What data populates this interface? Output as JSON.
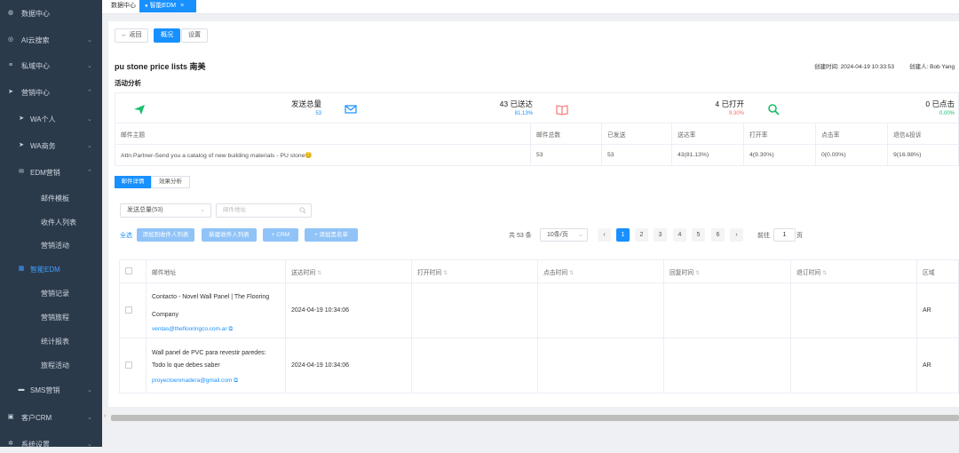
{
  "sidebar": {
    "items": [
      {
        "label": "数据中心",
        "icon": "dashboard-icon",
        "level": 0,
        "chevron": false
      },
      {
        "label": "AI云搜索",
        "icon": "globe-icon",
        "level": 0,
        "chevron": true
      },
      {
        "label": "私域中心",
        "icon": "list-icon",
        "level": 0,
        "chevron": true
      },
      {
        "label": "营销中心",
        "icon": "send-icon",
        "level": 0,
        "chevron": true
      },
      {
        "label": "WA个人",
        "icon": "send-icon",
        "level": 1,
        "chevron": true
      },
      {
        "label": "WA商务",
        "icon": "send-icon",
        "level": 1,
        "chevron": true
      },
      {
        "label": "EDM营销",
        "icon": "mail-icon",
        "level": 1,
        "chevron": true
      },
      {
        "label": "邮件模板",
        "icon": "",
        "level": 2,
        "chevron": false
      },
      {
        "label": "收件人列表",
        "icon": "",
        "level": 2,
        "chevron": false
      },
      {
        "label": "营销活动",
        "icon": "",
        "level": 2,
        "chevron": false
      },
      {
        "label": "智能EDM",
        "icon": "grid-icon",
        "level": 1,
        "chevron": false,
        "active": true
      },
      {
        "label": "营销记录",
        "icon": "",
        "level": 2,
        "chevron": false
      },
      {
        "label": "营销旅程",
        "icon": "",
        "level": 2,
        "chevron": false
      },
      {
        "label": "统计报表",
        "icon": "",
        "level": 2,
        "chevron": false
      },
      {
        "label": "旅程活动",
        "icon": "",
        "level": 2,
        "chevron": false
      },
      {
        "label": "SMS营销",
        "icon": "chat-icon",
        "level": 1,
        "chevron": true
      },
      {
        "label": "客户CRM",
        "icon": "users-icon",
        "level": 0,
        "chevron": true
      },
      {
        "label": "系统设置",
        "icon": "gear-icon",
        "level": 0,
        "chevron": true
      }
    ]
  },
  "tabs": {
    "home": "数据中心",
    "active": "智能EDM",
    "close": "×"
  },
  "toolbar": {
    "back": "← 返回",
    "overview": "概况",
    "settings": "设置"
  },
  "campaign": {
    "title": "pu stone price lists 南美",
    "created_time_label": "创建时间:",
    "created_time": "2024-04-19 10:33:53",
    "creator_label": "创建人:",
    "creator": "Bob Yang"
  },
  "section_title": "活动分析",
  "stats": [
    {
      "label": "发送总量",
      "sub": "53",
      "icon": "send-icon",
      "sub_color": "#1890ff"
    },
    {
      "label": "43 已送达",
      "sub": "81.13%",
      "icon": "mail-icon",
      "sub_color": "#1890ff"
    },
    {
      "label": "4 已打开",
      "sub": "9.30%",
      "icon": "book-icon",
      "sub_color": "#f56c6c"
    },
    {
      "label": "0 已点击",
      "sub": "0.00%",
      "icon": "search-icon",
      "sub_color": "#19be6b"
    }
  ],
  "summary_table": {
    "headers": [
      "邮件主题",
      "邮件总数",
      "已发送",
      "送达率",
      "打开率",
      "点击率",
      "退信&投诉"
    ],
    "row": [
      "Attn:Partner-Send you a catalog of new building materials - PU stone😊",
      "53",
      "53",
      "43(81.13%)",
      "4(9.30%)",
      "0(0.00%)",
      "9(16.98%)"
    ]
  },
  "subtabs": {
    "detail": "邮件详情",
    "effect": "效果分析"
  },
  "filters": {
    "select": "发送总量(53)",
    "email_placeholder": "邮件地址"
  },
  "actions": {
    "select_all": "全选",
    "add_list": "添加到收件人列表",
    "new_list": "新建收件人列表",
    "crm": "+ CRM",
    "blacklist": "+ 添加黑名单"
  },
  "pagination": {
    "total": "共 53 条",
    "page_size": "10条/页",
    "pages": [
      "1",
      "2",
      "3",
      "4",
      "5",
      "6"
    ],
    "goto": "前往",
    "goto_value": "1",
    "page_unit": "页",
    "prev": "‹",
    "next": "›"
  },
  "detail_table": {
    "headers": [
      "邮件地址",
      "送达时间",
      "打开时间",
      "点击时间",
      "回复时间",
      "退订时间",
      "区域"
    ],
    "rows": [
      {
        "name": "Contacto - Novel Wall Panel | The Flooring Company",
        "email": "ventas@theflooringco.com.ar",
        "delivered": "2024-04-19 10:34:06",
        "opened": "",
        "clicked": "",
        "replied": "",
        "unsub": "",
        "region": "AR"
      },
      {
        "name": "Wall panel de PVC para revestir paredes: Todo lo que debes saber",
        "email": "proyectoenmadera@gmail.com",
        "delivered": "2024-04-19 10:34:06",
        "opened": "",
        "clicked": "",
        "replied": "",
        "unsub": "",
        "region": "AR"
      }
    ]
  }
}
